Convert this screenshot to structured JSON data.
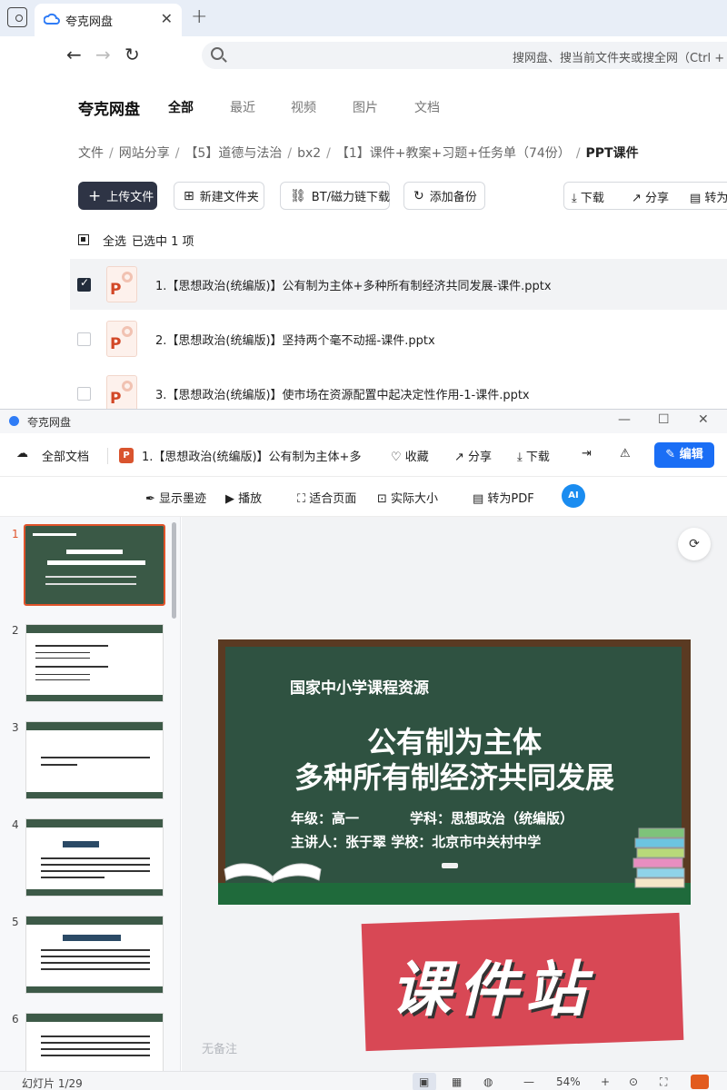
{
  "browser": {
    "tab_title": "夸克网盘",
    "tab_close": "✕",
    "new_tab": "+",
    "back": "←",
    "forward": "→",
    "reload": "↻",
    "address_placeholder": "搜网盘、搜当前文件夹或搜全网（Ctrl + F）"
  },
  "app": {
    "brand": "夸克网盘",
    "tabs": [
      "全部",
      "最近",
      "视频",
      "图片",
      "文档"
    ],
    "breadcrumb": [
      "文件",
      "网站分享",
      "【5】道德与法治",
      "bx2",
      "【1】课件+教案+习题+任务单（74份）",
      "PPT课件"
    ],
    "breadcrumb_sep": "/",
    "actions": {
      "upload": "上传文件",
      "new_folder": "新建文件夹",
      "bt_download": "BT/磁力链下载",
      "add_backup": "添加备份",
      "download": "下载",
      "share": "分享",
      "convert": "转为"
    },
    "selection": {
      "select_all": "全选",
      "selected_text": "已选中  1  项"
    },
    "files": [
      {
        "name": "1.【思想政治(统编版)】公有制为主体+多种所有制经济共同发展-课件.pptx",
        "selected": true
      },
      {
        "name": "2.【思想政治(统编版)】坚持两个毫不动摇-课件.pptx",
        "selected": false
      },
      {
        "name": "3.【思想政治(统编版)】使市场在资源配置中起决定性作用-1-课件.pptx",
        "selected": false
      }
    ]
  },
  "viewer": {
    "window_title": "夸克网盘",
    "all_docs": "全部文档",
    "file_title": "1.【思想政治(统编版)】公有制为主体+多",
    "toolbar": {
      "favorite": "收藏",
      "share": "分享",
      "download": "下载",
      "edit": "编辑"
    },
    "subtoolbar": {
      "show_ink": "显示墨迹",
      "play": "播放",
      "fit_page": "适合页面",
      "actual_size": "实际大小",
      "to_pdf": "转为PDF",
      "ai": "AI"
    },
    "thumbnails": [
      "1",
      "2",
      "3",
      "4",
      "5",
      "6"
    ],
    "slide": {
      "header": "国家中小学课程资源",
      "title_line1": "公有制为主体",
      "title_line2": "多种所有制经济共同发展",
      "grade": "年级：高一",
      "subject": "学科：思想政治（统编版）",
      "speaker": "主讲人：张于翠 学校：北京市中关村中学"
    },
    "watermark": "课件站",
    "notes": "无备注",
    "status": {
      "slide_counter": "幻灯片 1/29",
      "zoom": "54%",
      "zoom_minus": "—",
      "zoom_plus": "+"
    },
    "colors": {
      "accent": "#1a6ef5",
      "active_thumb": "#e0532a",
      "board": "#2f5241"
    }
  }
}
